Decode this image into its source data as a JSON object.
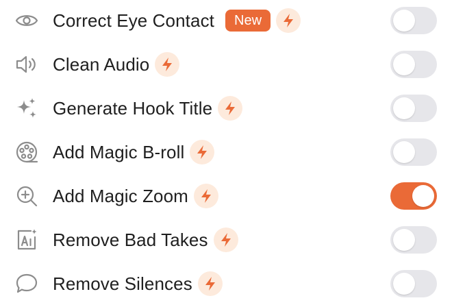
{
  "colors": {
    "accent": "#ea6a37",
    "bolt_bg": "#fdeadc",
    "toggle_off": "#e6e6ea",
    "icon_gray": "#8c8c8c"
  },
  "features": [
    {
      "label": "Correct Eye Contact",
      "icon": "eye-icon",
      "badge": "New",
      "enabled": false
    },
    {
      "label": "Clean Audio",
      "icon": "speaker-icon",
      "enabled": false
    },
    {
      "label": "Generate Hook Title",
      "icon": "sparkles-icon",
      "enabled": false
    },
    {
      "label": "Add Magic B-roll",
      "icon": "film-reel-icon",
      "enabled": false
    },
    {
      "label": "Add Magic Zoom",
      "icon": "zoom-in-icon",
      "enabled": true
    },
    {
      "label": "Remove Bad Takes",
      "icon": "ai-image-icon",
      "enabled": false
    },
    {
      "label": "Remove Silences",
      "icon": "speech-bubble-icon",
      "enabled": false
    }
  ]
}
